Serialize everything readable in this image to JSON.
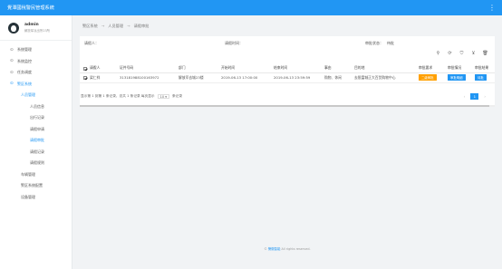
{
  "app": {
    "title": "覺潭國稅警民管理系統",
    "menu_icon": "more-vertical-icon"
  },
  "user": {
    "name": "admin",
    "org": "解放军派出所23所"
  },
  "sidebar": {
    "items": [
      {
        "label": "系统管理",
        "icon": "dot-icon",
        "level": 0
      },
      {
        "label": "系统监控",
        "icon": "dot-icon",
        "level": 0
      },
      {
        "label": "任务调度",
        "icon": "dot-icon",
        "level": 0
      },
      {
        "label": "警区系统",
        "icon": "dot-icon",
        "level": 0,
        "active": true
      },
      {
        "label": "人员管理",
        "level": 1,
        "active": true
      },
      {
        "label": "人员信息",
        "level": 2
      },
      {
        "label": "出行记录",
        "level": 2
      },
      {
        "label": "请假申请",
        "level": 2
      },
      {
        "label": "请假审批",
        "level": 2,
        "active": true
      },
      {
        "label": "请假记录",
        "level": 2
      },
      {
        "label": "请假规则",
        "level": 2
      },
      {
        "label": "车辆管理",
        "level": 1
      },
      {
        "label": "警区系统配置",
        "level": 1
      },
      {
        "label": "设备管理",
        "level": 1
      }
    ]
  },
  "breadcrumb": [
    "警区系统",
    "人员管理",
    "请假审批"
  ],
  "filters": {
    "person_label": "请假人：",
    "person_value": "",
    "time_label": "请假时间：",
    "time_value": "",
    "status_label": "审批状态：",
    "status_value": "待批"
  },
  "toolbar": {
    "icons": [
      "search-icon",
      "refresh-icon",
      "shield-icon",
      "filter-clear-icon",
      "delete-icon"
    ]
  },
  "table": {
    "headers": [
      "请假人",
      "证件号码",
      "部门",
      "开始时间",
      "结束时间",
      "事由",
      "目的地",
      "审批要求",
      "审批情况",
      "审批结果"
    ],
    "rows": [
      {
        "checked": true,
        "person": "梁仁祥",
        "id_number": "313181988100163972",
        "department": "解放军去城23楼",
        "start": "2019-06-13 17:00:00",
        "end": "2019-06-13 23:59:59",
        "reason": "购物、休闲",
        "destination": "去限富城正大百货购物中心",
        "req_btn": "二级审批",
        "status_btn": "审批明细",
        "result_btn": "待批"
      }
    ]
  },
  "pagination": {
    "summary_prefix": "显示第 1 到第 1 条记录，总共 1 条记录 每页显示",
    "page_size": "10",
    "summary_suffix": "条记录",
    "prev": "‹",
    "current_page": "1",
    "next": "›"
  },
  "footer": {
    "copyright": "©",
    "brand": "警徽智能",
    "rights": "All rights reserved."
  },
  "colors": {
    "primary": "#2196f3",
    "warning": "#ffa000",
    "background": "#f1f3f5"
  }
}
